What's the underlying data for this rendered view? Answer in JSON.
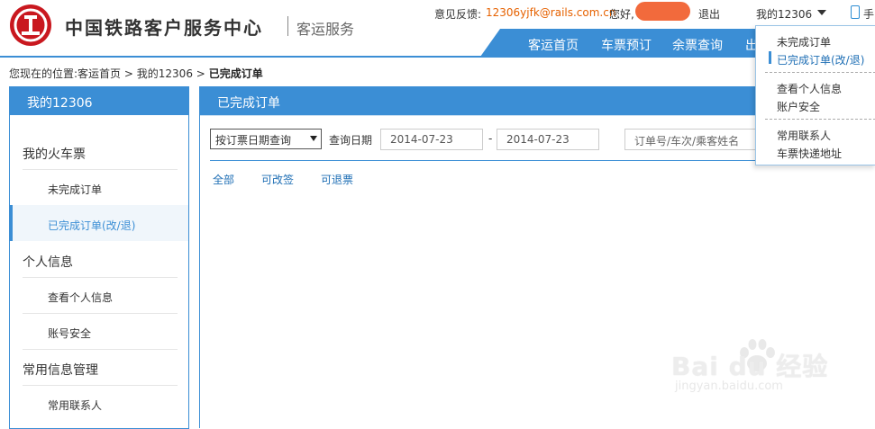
{
  "header": {
    "site_title": "中国铁路客户服务中心",
    "site_subtitle": "客运服务",
    "feedback_label": "意见反馈:",
    "feedback_email": "12306yjfk@rails.com.cn",
    "greeting": "您好,",
    "logout": "退出",
    "my_account": "我的12306",
    "mobile": "手"
  },
  "nav": {
    "items": [
      "客运首页",
      "车票预订",
      "余票查询",
      "出"
    ]
  },
  "dropdown": {
    "items": [
      "未完成订单",
      "已完成订单(改/退)",
      "查看个人信息",
      "账户安全",
      "常用联系人",
      "车票快递地址"
    ]
  },
  "breadcrumb": {
    "prefix": "您现在的位置:",
    "home": "客运首页",
    "sep": ">",
    "account": "我的12306",
    "current": "已完成订单"
  },
  "sidebar": {
    "title": "我的12306",
    "cat_tickets": "我的火车票",
    "item_unfinished": "未完成订单",
    "item_finished": "已完成订单(改/退)",
    "cat_personal": "个人信息",
    "item_view_info": "查看个人信息",
    "item_security": "账号安全",
    "cat_common": "常用信息管理",
    "item_contacts": "常用联系人"
  },
  "main": {
    "title": "已完成订单",
    "query_type": "按订票日期查询",
    "date_label": "查询日期",
    "date_from": "2014-07-23",
    "date_to": "2014-07-23",
    "dash": "-",
    "keyword_placeholder": "订单号/车次/乘客姓名",
    "filter_tabs": [
      "全部",
      "可改签",
      "可退票"
    ]
  },
  "watermark": {
    "brand": "Bai du 经验",
    "url": "jingyan.baidu.com"
  },
  "colors": {
    "brand_blue": "#3b8ed5",
    "logo_red": "#c9181f",
    "link_blue": "#1f6fb5",
    "email_orange": "#e66100"
  }
}
